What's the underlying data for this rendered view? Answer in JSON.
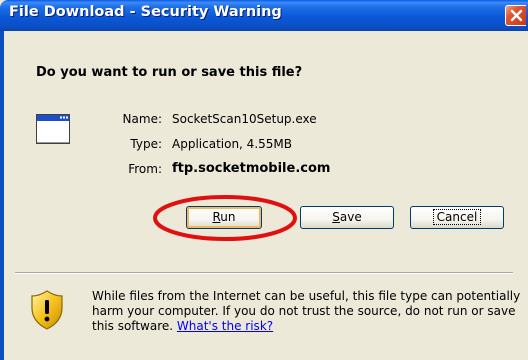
{
  "window": {
    "title": "File Download - Security Warning",
    "close_icon": "close-icon"
  },
  "dialog": {
    "question": "Do you want to run or save this file?",
    "file_icon": "application-window-icon",
    "name_label": "Name:",
    "name_value": "SocketScan10Setup.exe",
    "type_label": "Type:",
    "type_value": "Application, 4.55MB",
    "from_label": "From:",
    "from_value": "ftp.socketmobile.com"
  },
  "buttons": {
    "run": {
      "mnemonic": "R",
      "rest": "un"
    },
    "save": {
      "mnemonic": "S",
      "rest": "ave"
    },
    "cancel": {
      "label": "Cancel"
    }
  },
  "annotation": {
    "highlight_color": "#E01010"
  },
  "warning": {
    "icon": "shield-warning-icon",
    "text": "While files from the Internet can be useful, this file type can potentially harm your computer. If you do not trust the source, do not run or save this software.",
    "link": "What's the risk?"
  },
  "colors": {
    "titlebar": "#0A58D8",
    "dialog_bg": "#ECE9D8",
    "link": "#0000FF"
  }
}
